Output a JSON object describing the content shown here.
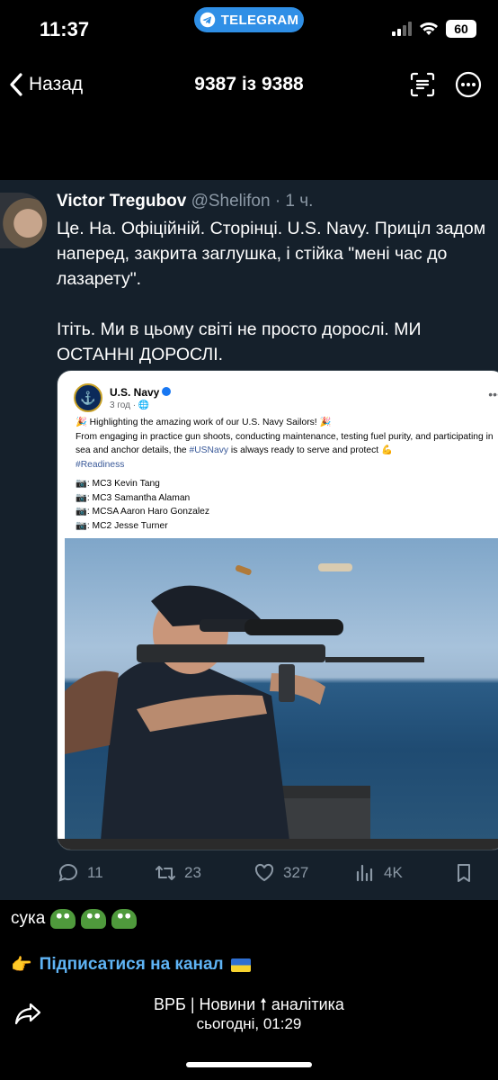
{
  "status_bar": {
    "time": "11:37",
    "pill_label": "TELEGRAM",
    "battery": "60"
  },
  "nav": {
    "back_label": "Назад",
    "title": "9387 із 9388"
  },
  "tweet": {
    "author_name": "Victor Tregubov",
    "author_handle": "@Shelifon",
    "separator": "·",
    "age": "1 ч.",
    "paragraphs": [
      "Це. На. Офіційній. Сторінці. U.S. Navy. Приціл задом наперед, закрита заглушка, і стійка \"мені час до лазарету\".",
      "Ітіть. Ми в цьому світі не просто дорослі. МИ ОСТАННІ ДОРОСЛІ."
    ],
    "embed": {
      "page_name": "U.S. Navy",
      "post_time": "3 год",
      "line1": "🎉 Highlighting the amazing work of our U.S. Navy Sailors! 🎉",
      "line2_a": "From engaging in practice gun shoots, conducting maintenance, testing fuel purity, and participating in sea and anchor details, the ",
      "line2_tag": "#USNavy",
      "line2_b": " is always ready to serve and protect 💪",
      "hashtag": "#Readiness",
      "credits": [
        "📷: MC3 Kevin Tang",
        "📷: MC3 Samantha Alaman",
        "📷: MCSA Aaron Haro Gonzalez",
        "📷: MC2 Jesse Turner"
      ]
    },
    "actions": {
      "replies": "11",
      "retweets": "23",
      "likes": "327",
      "views": "4K"
    }
  },
  "message": {
    "text": "сука"
  },
  "subscribe": {
    "emoji": "👉",
    "label": "Підписатися на канал"
  },
  "footer": {
    "channel": "ВРБ | Новини 🠕 аналітика",
    "date": "сьогодні, 01:29"
  }
}
